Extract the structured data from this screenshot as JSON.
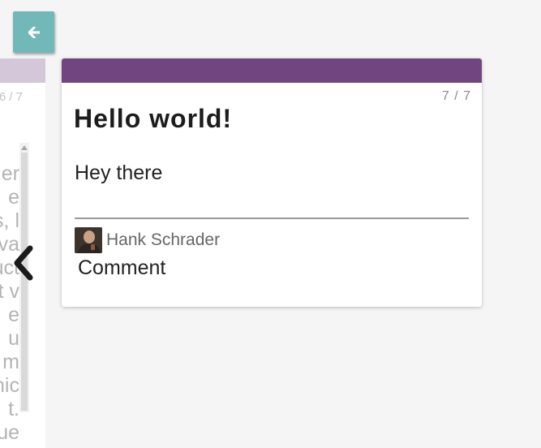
{
  "toolbar": {
    "back_icon": "arrow-left-icon",
    "back_color": "#72b8b8"
  },
  "prev_card": {
    "counter": "6 / 7",
    "body_lines": [
      "er",
      "e",
      "s, l",
      "va",
      "uct",
      "t v",
      "e",
      "u",
      "m",
      "nic",
      "t.",
      "ue"
    ],
    "header_color": "#d4c7d9"
  },
  "nav": {
    "prev_icon": "chevron-left-icon"
  },
  "card": {
    "header_color": "#71457f",
    "counter": "7 / 7",
    "title": "Hello world!",
    "body": "Hey there",
    "author": "Hank Schrader",
    "comment_label": "Comment"
  }
}
